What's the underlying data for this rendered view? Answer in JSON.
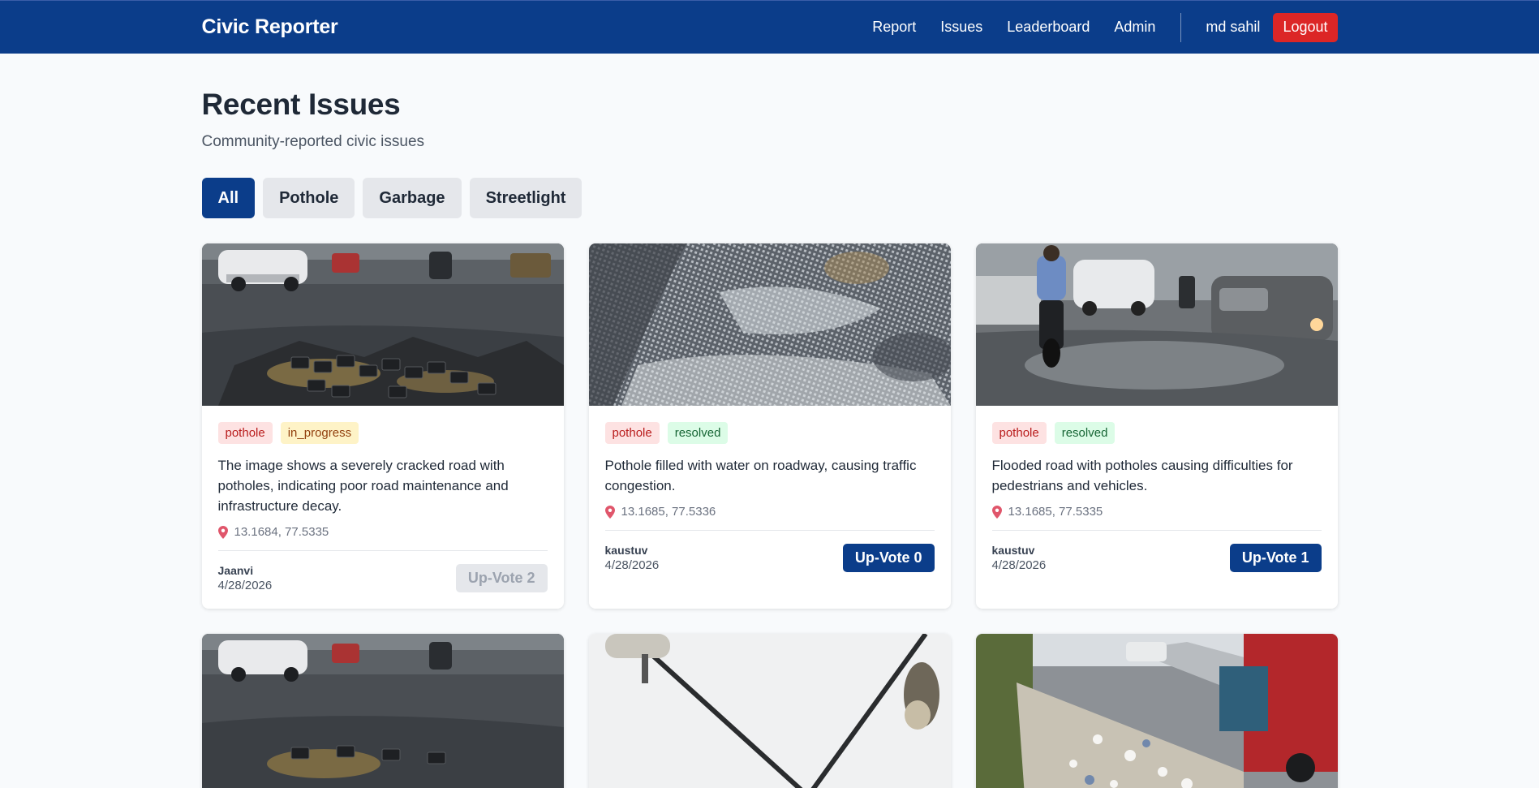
{
  "nav": {
    "brand": "Civic Reporter",
    "links": [
      "Report",
      "Issues",
      "Leaderboard",
      "Admin"
    ],
    "user": "md sahil",
    "logout": "Logout"
  },
  "page": {
    "title": "Recent Issues",
    "subtitle": "Community-reported civic issues"
  },
  "filters": [
    "All",
    "Pothole",
    "Garbage",
    "Streetlight"
  ],
  "active_filter": "All",
  "cards": [
    {
      "category": "pothole",
      "status": "in_progress",
      "description": "The image shows a severely cracked road with potholes, indicating poor road maintenance and infrastructure decay.",
      "location": "13.1684, 77.5335",
      "author": "Jaanvi",
      "date": "4/28/2026",
      "vote_label": "Up-Vote 2",
      "image": "cracked-road-photo"
    },
    {
      "category": "pothole",
      "status": "resolved",
      "description": "Pothole filled with water on roadway, causing traffic congestion.",
      "location": "13.1685, 77.5336",
      "author": "kaustuv",
      "date": "4/28/2026",
      "vote_label": "Up-Vote 0",
      "image": "water-pothole-photo"
    },
    {
      "category": "pothole",
      "status": "resolved",
      "description": "Flooded road with potholes causing difficulties for pedestrians and vehicles.",
      "location": "13.1685, 77.5335",
      "author": "kaustuv",
      "date": "4/28/2026",
      "vote_label": "Up-Vote 1",
      "image": "flooded-road-photo"
    }
  ],
  "colors": {
    "navbar": "#0b3d8a",
    "logout": "#dc2626",
    "primary": "#0b3d8a"
  }
}
